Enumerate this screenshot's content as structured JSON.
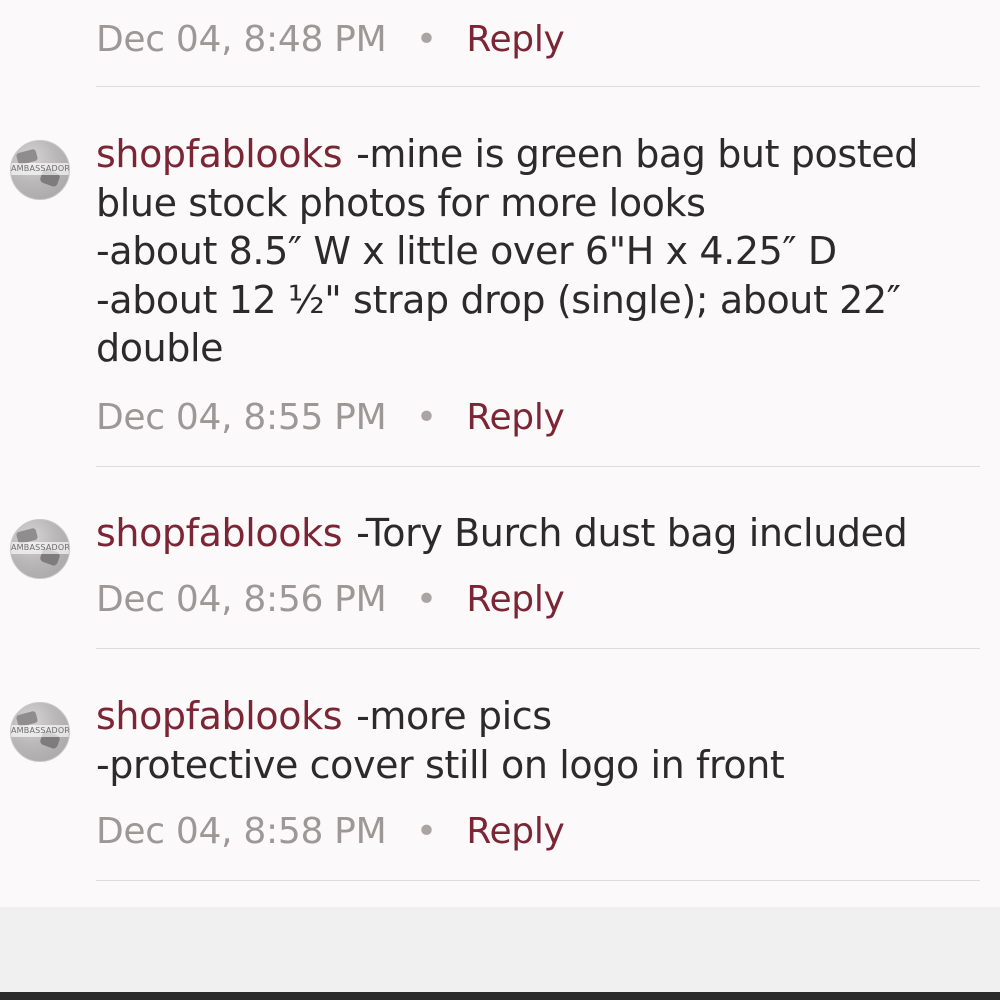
{
  "comments": [
    {
      "timestamp": "Dec 04, 8:48 PM",
      "separator": "•",
      "reply_label": "Reply"
    },
    {
      "avatar_label": "AMBASSADOR",
      "username": "shopfablooks",
      "text_first": "-mine is green bag but posted",
      "text_lines": [
        "blue stock photos for more looks",
        "-about 8.5″ W x little over 6\"H x 4.25″ D",
        "-about 12 ½\" strap drop (single); about 22″",
        "double"
      ],
      "timestamp": "Dec 04, 8:55 PM",
      "separator": "•",
      "reply_label": "Reply"
    },
    {
      "avatar_label": "AMBASSADOR",
      "username": "shopfablooks",
      "text_first": "-Tory Burch dust bag included",
      "text_lines": [],
      "timestamp": "Dec 04, 8:56 PM",
      "separator": "•",
      "reply_label": "Reply"
    },
    {
      "avatar_label": "AMBASSADOR",
      "username": "shopfablooks",
      "text_first": "-more pics",
      "text_lines": [
        "-protective cover still on logo in front"
      ],
      "timestamp": "Dec 04, 8:58 PM",
      "separator": "•",
      "reply_label": "Reply"
    }
  ],
  "colors": {
    "username": "#7c2535",
    "reply": "#7c2535",
    "meta": "#9c9898",
    "text": "#2c2a2b",
    "background": "#fbf9fa"
  }
}
